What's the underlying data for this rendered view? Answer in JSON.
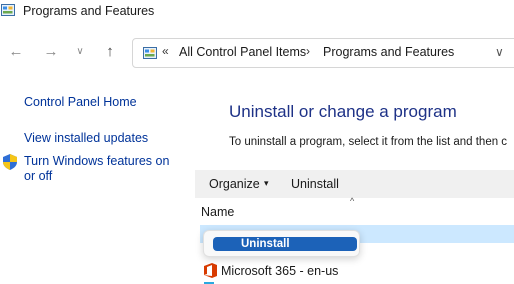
{
  "window": {
    "title": "Programs and Features",
    "title_icon": "control-panel-icon"
  },
  "nav": {
    "back_icon": "arrow-left-icon",
    "forward_icon": "arrow-right-icon",
    "recent_icon": "chevron-down-icon",
    "up_icon": "arrow-up-icon"
  },
  "address": {
    "icon": "control-panel-icon",
    "separator_lead": "«",
    "separator": "›",
    "crumbs": [
      "All Control Panel Items",
      "Programs and Features"
    ],
    "dropdown_icon": "chevron-down-icon"
  },
  "sidebar": {
    "home": "Control Panel Home",
    "updates": "View installed updates",
    "features": "Turn Windows features on or off",
    "features_icon": "shield-icon"
  },
  "main": {
    "heading": "Uninstall or change a program",
    "description": "To uninstall a program, select it from the list and then c"
  },
  "toolbar": {
    "organize": "Organize",
    "organize_caret": "▾",
    "uninstall": "Uninstall"
  },
  "list": {
    "sort_indicator": "^",
    "column_name": "Name",
    "rows": [
      {
        "label": "",
        "selected": true
      },
      {
        "label": "Microsoft 365 - en-us",
        "icon": "office-icon"
      }
    ]
  },
  "context_menu": {
    "items": [
      {
        "label": "Uninstall"
      }
    ]
  },
  "colors": {
    "accent": "#1c62b8",
    "selection": "#cce8ff",
    "link": "#003399",
    "heading": "#1e3287",
    "toolbar_bg": "#f0f0f0"
  }
}
